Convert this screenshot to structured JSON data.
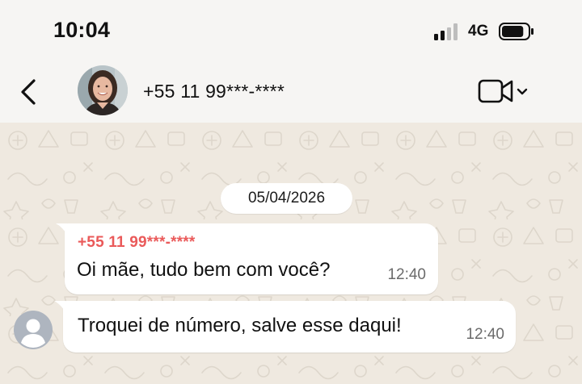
{
  "status_bar": {
    "time": "10:04",
    "network": "4G",
    "signal_bars_active": 2,
    "signal_bars_total": 4,
    "battery_level": 0.85
  },
  "header": {
    "contact_name": "+55 11 99***-****",
    "icons": {
      "back": "chevron-left-icon",
      "video": "video-camera-icon",
      "dropdown": "chevron-down-icon"
    }
  },
  "chat": {
    "date_separator": "05/04/2026",
    "messages": [
      {
        "sender": "+55 11 99***-****",
        "text": "Oi mãe, tudo bem com você?",
        "time": "12:40"
      },
      {
        "text": "Troquei de número, salve esse daqui!",
        "time": "12:40"
      }
    ]
  },
  "colors": {
    "sender_name": "#ea5a5a",
    "chat_background": "#efe9e0",
    "bubble": "#ffffff",
    "header_background": "#f6f5f3"
  }
}
